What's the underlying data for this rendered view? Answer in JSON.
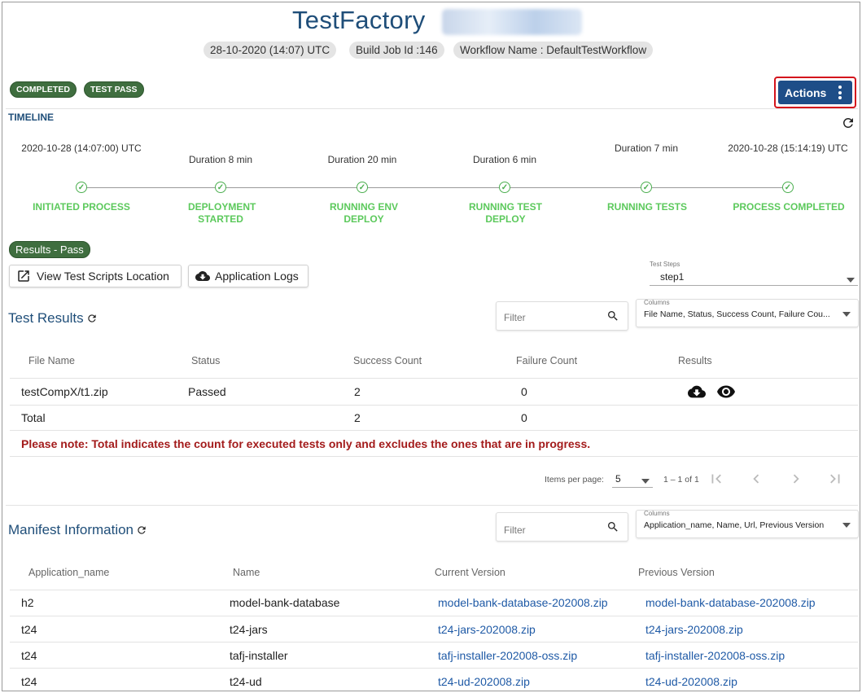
{
  "header": {
    "title": "TestFactory",
    "chips": [
      "28-10-2020 (14:07) UTC",
      "Build Job Id :146",
      "Workflow Name : DefaultTestWorkflow"
    ]
  },
  "status_badges": [
    "COMPLETED",
    "TEST PASS"
  ],
  "actions": {
    "label": "Actions"
  },
  "timeline": {
    "heading": "TIMELINE",
    "tops": [
      "2020-10-28 (14:07:00) UTC",
      "Duration 8 min",
      "Duration 20 min",
      "Duration 6 min",
      "Duration 7 min",
      "2020-10-28 (15:14:19) UTC"
    ],
    "steps": [
      "INITIATED PROCESS",
      "DEPLOYMENT STARTED",
      "RUNNING ENV DEPLOY",
      "RUNNING TEST DEPLOY",
      "RUNNING TESTS",
      "PROCESS COMPLETED"
    ]
  },
  "results_badge": "Results - Pass",
  "buttons": {
    "view_scripts": "View Test Scripts Location",
    "app_logs": "Application Logs"
  },
  "test_steps": {
    "label": "Test Steps",
    "value": "step1"
  },
  "test_results": {
    "title": "Test Results",
    "filter_placeholder": "Filter",
    "columns_label": "Columns",
    "columns_value": "File Name, Status, Success Count, Failure Cou...",
    "headers": [
      "File Name",
      "Status",
      "Success Count",
      "Failure Count",
      "Results"
    ],
    "rows": [
      {
        "file": "testCompX/t1.zip",
        "status": "Passed",
        "success": "2",
        "failure": "0"
      },
      {
        "file": "Total",
        "status": "",
        "success": "2",
        "failure": "0"
      }
    ],
    "note": "Please note: Total indicates the count for executed tests only and excludes the ones that are in progress.",
    "pagination": {
      "items_label": "Items per page:",
      "page_size": "5",
      "range": "1 – 1 of 1"
    }
  },
  "manifest": {
    "title": "Manifest Information",
    "filter_placeholder": "Filter",
    "columns_label": "Columns",
    "columns_value": "Application_name, Name, Url, Previous Version",
    "headers": [
      "Application_name",
      "Name",
      "Current Version",
      "Previous Version"
    ],
    "rows": [
      {
        "app": "h2",
        "name": "model-bank-database",
        "current": "model-bank-database-202008.zip",
        "previous": "model-bank-database-202008.zip"
      },
      {
        "app": "t24",
        "name": "t24-jars",
        "current": "t24-jars-202008.zip",
        "previous": "t24-jars-202008.zip"
      },
      {
        "app": "t24",
        "name": "tafj-installer",
        "current": "tafj-installer-202008-oss.zip",
        "previous": "tafj-installer-202008-oss.zip"
      },
      {
        "app": "t24",
        "name": "t24-ud",
        "current": "t24-ud-202008.zip",
        "previous": "t24-ud-202008.zip"
      }
    ]
  },
  "colors": {
    "brand_blue": "#1f4e79",
    "action_blue": "#1e4e88",
    "success_green": "#5cc95c",
    "badge_green": "#3f6e3f",
    "note_red": "#a31b1b",
    "link_blue": "#1f5aa6"
  }
}
